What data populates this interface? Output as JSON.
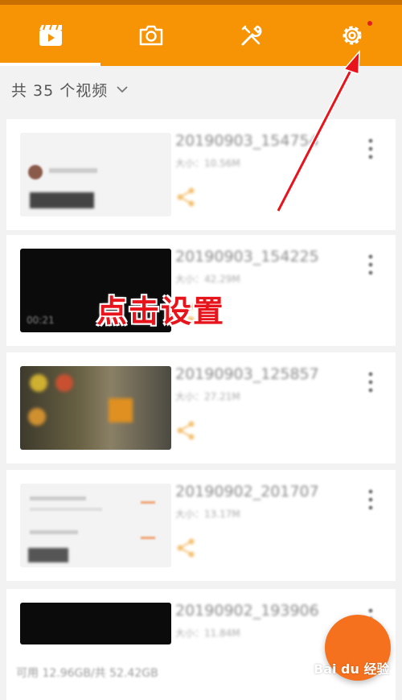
{
  "topbar": {
    "tabs": [
      {
        "icon": "video-clapper-icon",
        "active": true
      },
      {
        "icon": "camera-icon",
        "active": false
      },
      {
        "icon": "tools-icon",
        "active": false
      },
      {
        "icon": "gear-icon",
        "active": false,
        "badge": true
      }
    ],
    "colors": {
      "background": "#f79406",
      "badge": "#e02020"
    }
  },
  "header": {
    "count_label": "共 35 个视频",
    "dropdown_icon": "chevron-down-icon"
  },
  "videos": [
    {
      "title": "20190903_154754",
      "meta": "大小：10.56M",
      "thumbnail": "document"
    },
    {
      "title": "20190903_154225",
      "meta": "大小：42.29M",
      "duration": "00:21",
      "thumbnail": "black"
    },
    {
      "title": "20190903_125857",
      "meta": "大小：27.21M",
      "thumbnail": "video"
    },
    {
      "title": "20190902_201707",
      "meta": "大小：13.17M",
      "thumbnail": "document"
    },
    {
      "title": "20190902_193906",
      "meta": "大小：11.84M",
      "thumbnail": "black"
    }
  ],
  "footer": {
    "storage_text": "可用 12.96GB/共 52.42GB"
  },
  "annotation": {
    "text": "点击设置",
    "color": "#e8141b"
  },
  "watermark": {
    "text": "Bai du 经验"
  }
}
